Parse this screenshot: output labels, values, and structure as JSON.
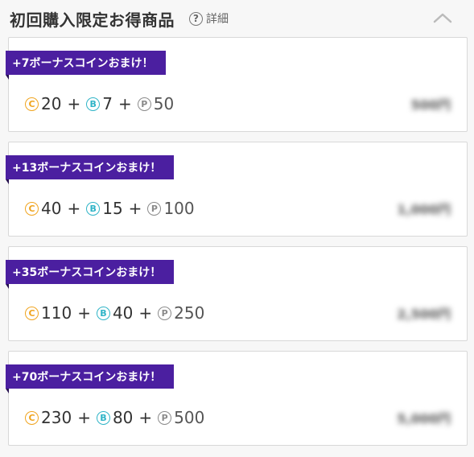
{
  "header": {
    "title": "初回購入限定お得商品",
    "help_icon": "?",
    "help_label": "詳細",
    "collapse_icon": "chevron-up-icon"
  },
  "products": [
    {
      "ribbon": "+7ボーナスコインおまけ！",
      "coin_c": "20",
      "coin_b": "7",
      "coin_p": "50",
      "price": "500円"
    },
    {
      "ribbon": "+13ボーナスコインおまけ！",
      "coin_c": "40",
      "coin_b": "15",
      "coin_p": "100",
      "price": "1,000円"
    },
    {
      "ribbon": "+35ボーナスコインおまけ！",
      "coin_c": "110",
      "coin_b": "40",
      "coin_p": "250",
      "price": "2,500円"
    },
    {
      "ribbon": "+70ボーナスコインおまけ！",
      "coin_c": "230",
      "coin_b": "80",
      "coin_p": "500",
      "price": "5,000円"
    }
  ],
  "labels": {
    "plus": "+",
    "coin_c_glyph": "C",
    "coin_b_glyph": "B",
    "coin_p_glyph": "P"
  },
  "colors": {
    "ribbon": "#4b1fa0",
    "coin_c": "#f0a41e",
    "coin_b": "#2fb4c7",
    "coin_p": "#8a8a8a"
  }
}
